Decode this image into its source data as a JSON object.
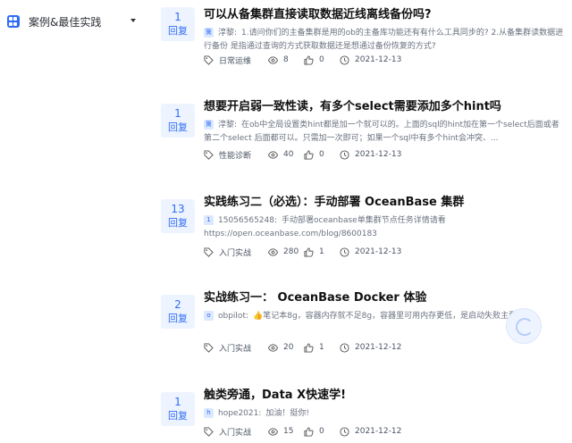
{
  "sidebar": {
    "category_label": "案例&最佳实践",
    "icon": "category-grid-icon"
  },
  "icons": {
    "tag": "tag-icon",
    "views": "eye-icon",
    "likes": "thumbs-up-icon",
    "time": "clock-icon"
  },
  "posts": [
    {
      "replies": "1",
      "reply_label": "回复",
      "title": "可以从备集群直接读取数据近线离线备份吗?",
      "avatar": "篱",
      "user": "淳黎:",
      "excerpt": "1.请问你们的主备集群是用的ob的主备库功能还有有什么工具同步的? 2.从备集群读数据进行备份 是指通过查询的方式获取数据还是想通过备份恢复的方式?",
      "tag": "日常运维",
      "views": "8",
      "likes": "0",
      "date": "2021-12-13"
    },
    {
      "replies": "1",
      "reply_label": "回复",
      "title": "想要开启弱一致性读，有多个select需要添加多个hint吗",
      "avatar": "篱",
      "user": "淳黎:",
      "excerpt": "在ob中全局设置类hint都是加一个就可以的。上面的sql的hint加在第一个select后面或者第二个select 后面都可以。只需加一次即可；如果一个sql中有多个hint会冲突、...",
      "tag": "性能诊断",
      "views": "40",
      "likes": "0",
      "date": "2021-12-13"
    },
    {
      "replies": "13",
      "reply_label": "回复",
      "title": "实践练习二（必选）：手动部署 OceanBase 集群",
      "avatar": "1",
      "user": "15056565248:",
      "excerpt": "手动部署oceanbase单集群节点任务详情请看",
      "url": "https://open.oceanbase.com/blog/8600183",
      "tag": "入门实战",
      "views": "280",
      "likes": "1",
      "date": "2021-12-13"
    },
    {
      "replies": "2",
      "reply_label": "回复",
      "title": "实战练习一： OceanBase Docker 体验",
      "avatar": "o",
      "user": "obpilot:",
      "excerpt": "👍笔记本8g，容器内存就不足8g，容器里可用内存更低，是启动失败主要原因。",
      "tag": "入门实战",
      "views": "20",
      "likes": "1",
      "date": "2021-12-12"
    },
    {
      "replies": "1",
      "reply_label": "回复",
      "title": "触类旁通，Data X快速学!",
      "avatar": "h",
      "user": "hope2021:",
      "excerpt": "加油！挺你!",
      "tag": "入门实战",
      "views": "15",
      "likes": "0",
      "date": "2021-12-12"
    }
  ]
}
